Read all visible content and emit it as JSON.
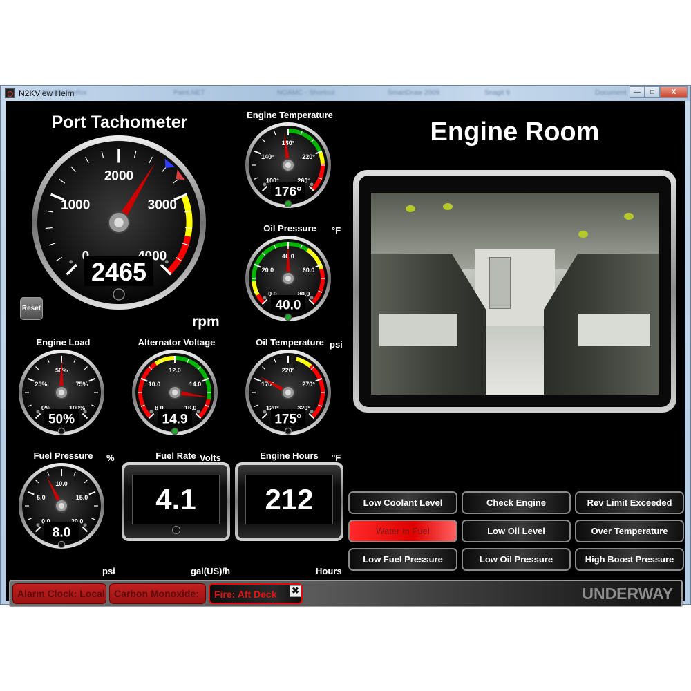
{
  "window": {
    "title": "N2KView Helm",
    "background_tabs": [
      "Mozilla Firefox",
      "Paint.NET",
      "NOAMC - Shortcut",
      "SmartDraw 2009",
      "Snagit 9",
      "Document"
    ],
    "controls": {
      "minimize": "—",
      "maximize": "□",
      "close": "X"
    }
  },
  "tachometer": {
    "title": "Port Tachometer",
    "value": 2465,
    "display": "2465",
    "unit": "rpm",
    "min": 0,
    "max": 4000,
    "tick_labels": [
      "0",
      "1000",
      "2000",
      "3000",
      "4000"
    ],
    "zones": [
      {
        "from": 3000,
        "to": 3500,
        "color": "#ffff00"
      },
      {
        "from": 3500,
        "to": 4000,
        "color": "#ff0000"
      }
    ],
    "markers": [
      {
        "value": 2600,
        "color": "#3040ff"
      },
      {
        "value": 2780,
        "color": "#e04040"
      }
    ],
    "reset_label": "Reset"
  },
  "gauges": {
    "engine_temperature": {
      "title": "Engine Temperature",
      "value": 176,
      "display": "176°",
      "unit": "°F",
      "min": 100,
      "max": 260,
      "labels": [
        "100°",
        "140°",
        "180°",
        "220°",
        "260°"
      ],
      "zones": [
        {
          "from": 180,
          "to": 220,
          "color": "#00b400"
        },
        {
          "from": 220,
          "to": 232,
          "color": "#ffff00"
        },
        {
          "from": 232,
          "to": 260,
          "color": "#ff0000"
        }
      ],
      "indicator": "green"
    },
    "oil_pressure": {
      "title": "Oil Pressure",
      "value": 40.0,
      "display": "40.0",
      "unit": "psi",
      "min": 0,
      "max": 80,
      "labels": [
        "0.0",
        "20.0",
        "40.0",
        "60.0",
        "80.0"
      ],
      "zones": [
        {
          "from": 0,
          "to": 5,
          "color": "#ff0000"
        },
        {
          "from": 5,
          "to": 12,
          "color": "#ffff00"
        },
        {
          "from": 12,
          "to": 50,
          "color": "#00b400"
        },
        {
          "from": 50,
          "to": 62,
          "color": "#ffff00"
        },
        {
          "from": 62,
          "to": 80,
          "color": "#ff0000"
        }
      ],
      "indicator": "green"
    },
    "oil_temperature": {
      "title": "Oil Temperature",
      "value": 175,
      "display": "175°",
      "unit": "°F",
      "min": 120,
      "max": 320,
      "labels": [
        "120°",
        "170°",
        "220°",
        "270°",
        "320°"
      ],
      "zones": [
        {
          "from": 230,
          "to": 250,
          "color": "#ffff00"
        },
        {
          "from": 250,
          "to": 320,
          "color": "#ff0000"
        }
      ],
      "indicator": "off"
    },
    "engine_load": {
      "title": "Engine Load",
      "value": 50,
      "display": "50%",
      "unit": "%",
      "min": 0,
      "max": 100,
      "labels": [
        "0%",
        "25%",
        "50%",
        "75%",
        "100%"
      ],
      "zones": [],
      "indicator": "off"
    },
    "alternator_voltage": {
      "title": "Alternator Voltage",
      "value": 14.9,
      "display": "14.9",
      "unit": "Volts",
      "min": 8,
      "max": 16,
      "labels": [
        "8.0",
        "10.0",
        "12.0",
        "14.0",
        "16.0"
      ],
      "zones": [
        {
          "from": 8,
          "to": 11,
          "color": "#ff0000"
        },
        {
          "from": 11,
          "to": 12,
          "color": "#ffff00"
        },
        {
          "from": 12,
          "to": 15,
          "color": "#00b400"
        },
        {
          "from": 15,
          "to": 16,
          "color": "#ff0000"
        }
      ],
      "indicator": "green"
    },
    "fuel_pressure": {
      "title": "Fuel Pressure",
      "value": 8.0,
      "display": "8.0",
      "unit": "psi",
      "min": 0,
      "max": 20,
      "labels": [
        "0.0",
        "5.0",
        "10.0",
        "15.0",
        "20.0"
      ],
      "zones": [],
      "indicator": "off"
    }
  },
  "readouts": {
    "fuel_rate": {
      "title": "Fuel Rate",
      "value": "4.1",
      "unit": "gal(US)/h"
    },
    "engine_hours": {
      "title": "Engine Hours",
      "value": "212",
      "unit": "Hours"
    }
  },
  "camera": {
    "title": "Engine Room"
  },
  "alarm_buttons": [
    {
      "label": "Low Coolant Level",
      "active": false
    },
    {
      "label": "Check Engine",
      "active": false
    },
    {
      "label": "Rev Limit Exceeded",
      "active": false
    },
    {
      "label": "Water In Fuel",
      "active": true
    },
    {
      "label": "Low Oil Level",
      "active": false
    },
    {
      "label": "Over Temperature",
      "active": false
    },
    {
      "label": "Low Fuel Pressure",
      "active": false
    },
    {
      "label": "Low Oil Pressure",
      "active": false
    },
    {
      "label": "High Boost Pressure",
      "active": false
    }
  ],
  "status_bar": {
    "alarms": [
      "Alarm Clock: Local",
      "Carbon Monoxide:",
      "Fire: Aft Deck"
    ],
    "dismiss_label": "✖",
    "mode": "UNDERWAY"
  }
}
